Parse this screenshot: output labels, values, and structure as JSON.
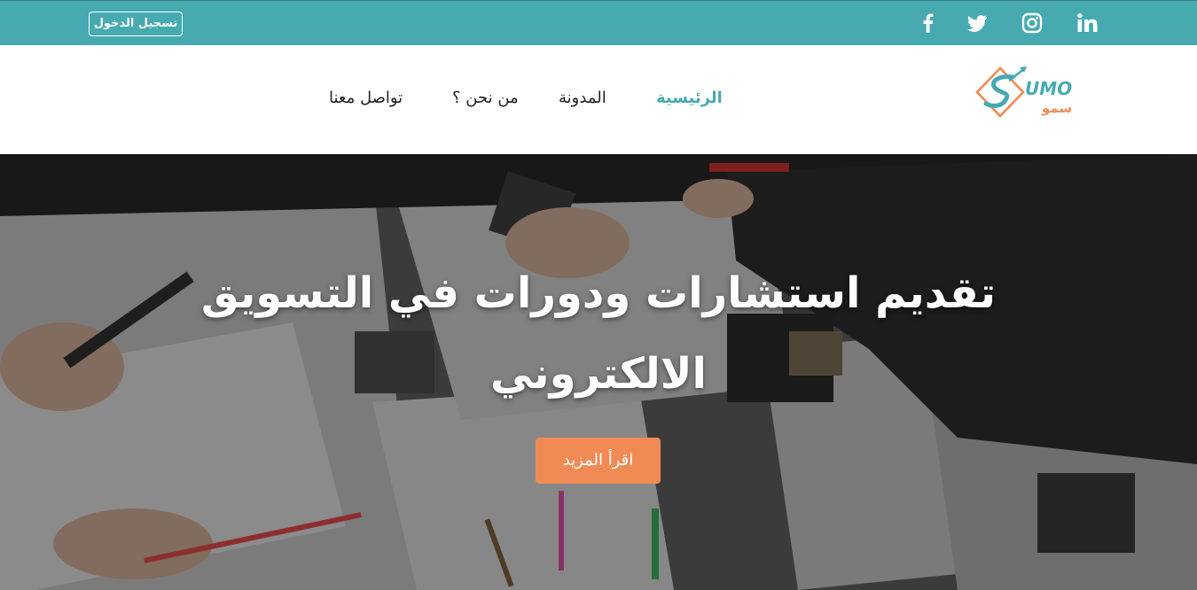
{
  "topbar": {
    "login_label": "تسجيل الدخول",
    "background_color": "#46aab0",
    "social_icons": [
      "facebook-icon",
      "twitter-icon",
      "instagram-icon",
      "linkedin-icon"
    ]
  },
  "navbar": {
    "items": [
      {
        "label": "الرئيسية",
        "active": true
      },
      {
        "label": "المدونة",
        "active": false
      },
      {
        "label": "من نحن ؟",
        "active": false
      },
      {
        "label": "تواصل معنا",
        "active": false
      }
    ],
    "active_color": "#46aab0"
  },
  "logo": {
    "text_latin": "UMO",
    "text_arabic": "سمو"
  },
  "hero": {
    "title": "تقديم استشارات ودورات في التسويق الالكتروني",
    "button_label": "اقرأ المزيد",
    "button_color": "#f08b55"
  }
}
